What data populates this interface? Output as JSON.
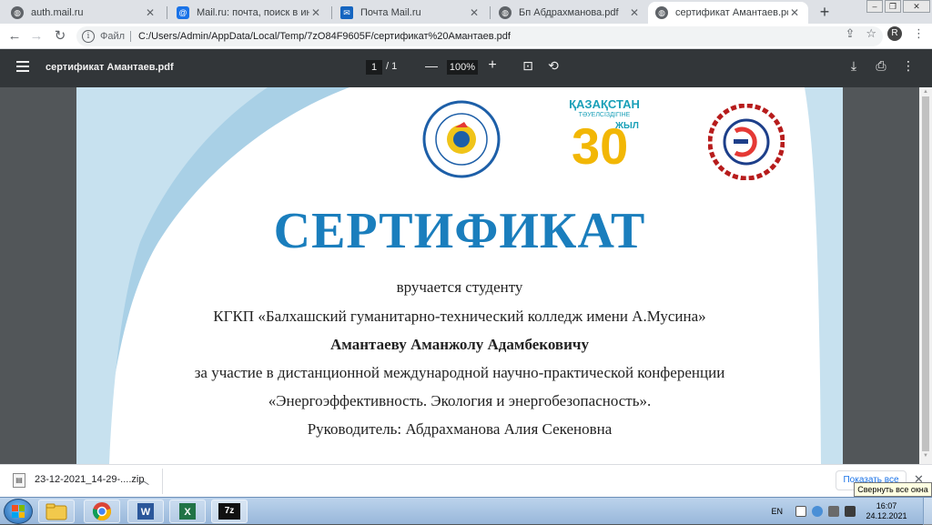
{
  "browser": {
    "tabs": [
      {
        "title": "auth.mail.ru",
        "favicon": "globe-icon",
        "active": false
      },
      {
        "title": "Mail.ru: почта, поиск в интерне",
        "favicon": "mailru-icon",
        "active": false
      },
      {
        "title": "Почта Mail.ru",
        "favicon": "mail-icon",
        "active": false
      },
      {
        "title": "Бп Абдрахманова.pdf",
        "favicon": "globe-icon",
        "active": false
      },
      {
        "title": "сертификат Амантаев.pdf",
        "favicon": "globe-icon",
        "active": true
      }
    ],
    "new_tab_label": "+",
    "address": {
      "scheme_label": "Файл",
      "url": "C:/Users/Admin/AppData/Local/Temp/7zO84F9605F/сертификат%20Амантаев.pdf"
    },
    "profile_initial": "R"
  },
  "pdf_viewer": {
    "title": "сертификат Амантаев.pdf",
    "current_page": "1",
    "page_total": "/ 1",
    "zoom": "100%"
  },
  "certificate": {
    "logos": {
      "left_ring_text_top": "ШҚОТжКББ және КД орталығы",
      "left_ring_text_bottom": "Центр ТиПО и ПК ВКО",
      "center_top": "ҚАЗАҚСТАН",
      "center_sub": "ТӘУЕЛСІЗДІГІНЕ",
      "center_number": "30",
      "center_word": "ЖЫЛ",
      "right_ring_text": "Шығыс Қазақстан колледжі «энергетика» колледжі"
    },
    "title": "СЕРТИФИКАТ",
    "lines": [
      "вручается студенту",
      "КГКП «Балхашский гуманитарно-технический колледж имени А.Мусина»",
      "Амантаеву Аманжолу Адамбековичу",
      "за участие в дистанционной международной научно-практической конференции",
      "«Энергоэффективность. Экология и энергобезопасность».",
      "Руководитель: Абдрахманова Алия Секеновна"
    ],
    "accent_color": "#1a7ebd"
  },
  "download_bar": {
    "file_name": "23-12-2021_14-29-....zip",
    "show_all_label": "Показать все",
    "tooltip": "Свернуть все окна"
  },
  "taskbar": {
    "apps": [
      "explorer-icon",
      "chrome-icon",
      "word-icon",
      "excel-icon",
      "7zip-icon"
    ],
    "seven_zip_label": "7z",
    "language": "EN",
    "time": "16:07",
    "date": "24.12.2021"
  }
}
